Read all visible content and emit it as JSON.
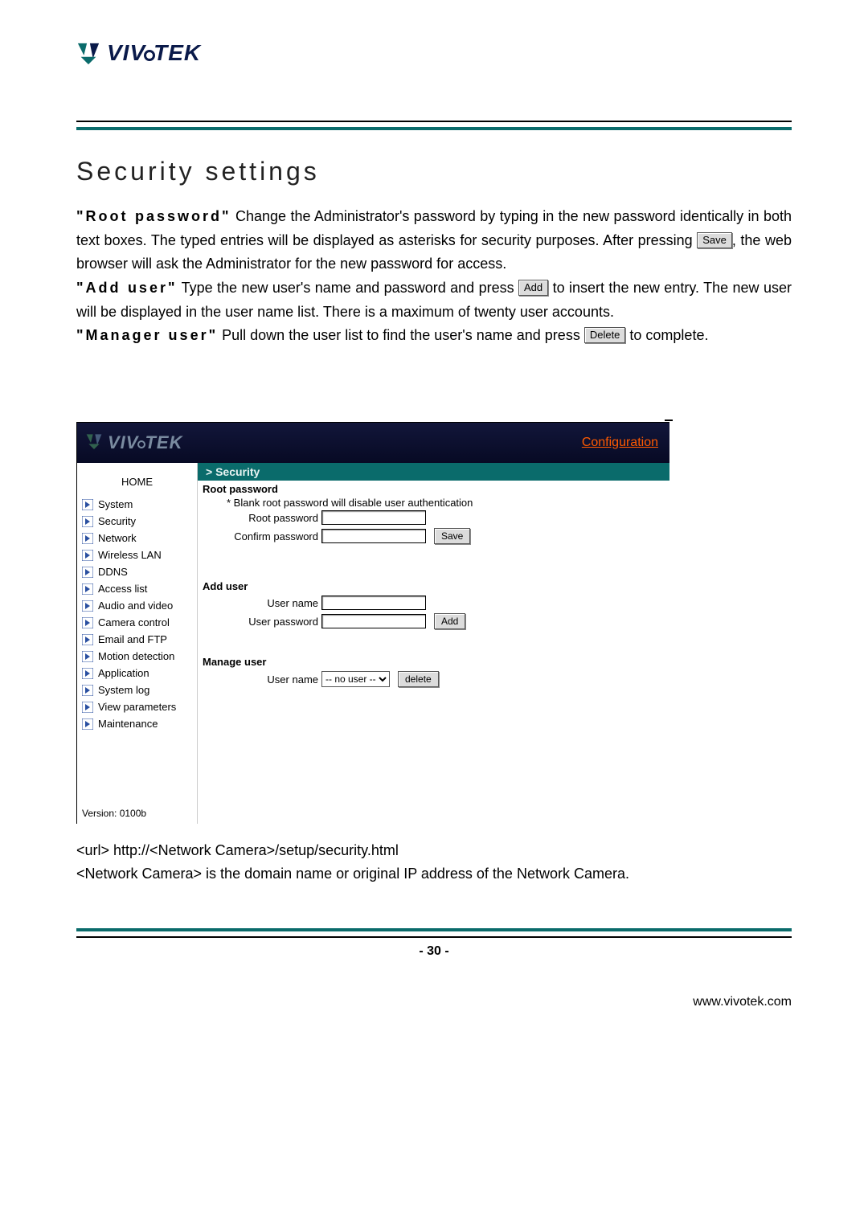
{
  "brand": {
    "name": "VIVOTEK"
  },
  "heading": "Security settings",
  "intro": {
    "root_password_label": "\"Root password\"",
    "root_password_text_before": "Change the Administrator's password by typing in the new password identically in both text boxes. The typed entries will be displayed as asterisks for security purposes. After pressing ",
    "root_password_text_save": "Save",
    "root_password_text_after": ", the web browser will ask the Administrator for the new password for access.",
    "add_user_label": "\"Add user\"",
    "add_user_text_before": "Type the new user's name and password and press ",
    "add_user_btn": "Add",
    "add_user_text_after": " to insert the new entry. The new user will be displayed in the user name list. There is a maximum of twenty user accounts.",
    "manager_user_label": "\"Manager user\"",
    "manager_user_text_before": "Pull down the user list to find the user's name and press ",
    "manager_user_btn": "Delete",
    "manager_user_text_after": " to complete."
  },
  "panel": {
    "configuration_label": "Configuration",
    "crumb": "> Security",
    "root_password": {
      "title": "Root password",
      "note": "* Blank root password will disable user authentication",
      "pw_label": "Root password",
      "confirm_label": "Confirm password",
      "save_btn": "Save"
    },
    "add_user": {
      "title": "Add user",
      "user_label": "User name",
      "pw_label": "User password",
      "add_btn": "Add"
    },
    "manage_user": {
      "title": "Manage user",
      "user_label": "User name",
      "select_value": "-- no user --",
      "delete_btn": "delete"
    }
  },
  "sidebar": {
    "home": "HOME",
    "items": [
      {
        "label": "System"
      },
      {
        "label": "Security"
      },
      {
        "label": "Network"
      },
      {
        "label": "Wireless LAN"
      },
      {
        "label": "DDNS"
      },
      {
        "label": "Access list"
      },
      {
        "label": "Audio and video"
      },
      {
        "label": "Camera control"
      },
      {
        "label": "Email and FTP"
      },
      {
        "label": "Motion detection"
      },
      {
        "label": "Application"
      },
      {
        "label": "System log"
      },
      {
        "label": "View parameters"
      },
      {
        "label": "Maintenance"
      }
    ],
    "version": "Version: 0100b"
  },
  "url_block": {
    "line1": "<url> http://<Network Camera>/setup/security.html",
    "line2": "<Network Camera> is the domain name or original IP address of the Network Camera."
  },
  "page_number": "- 30 -",
  "footer_url": "www.vivotek.com"
}
